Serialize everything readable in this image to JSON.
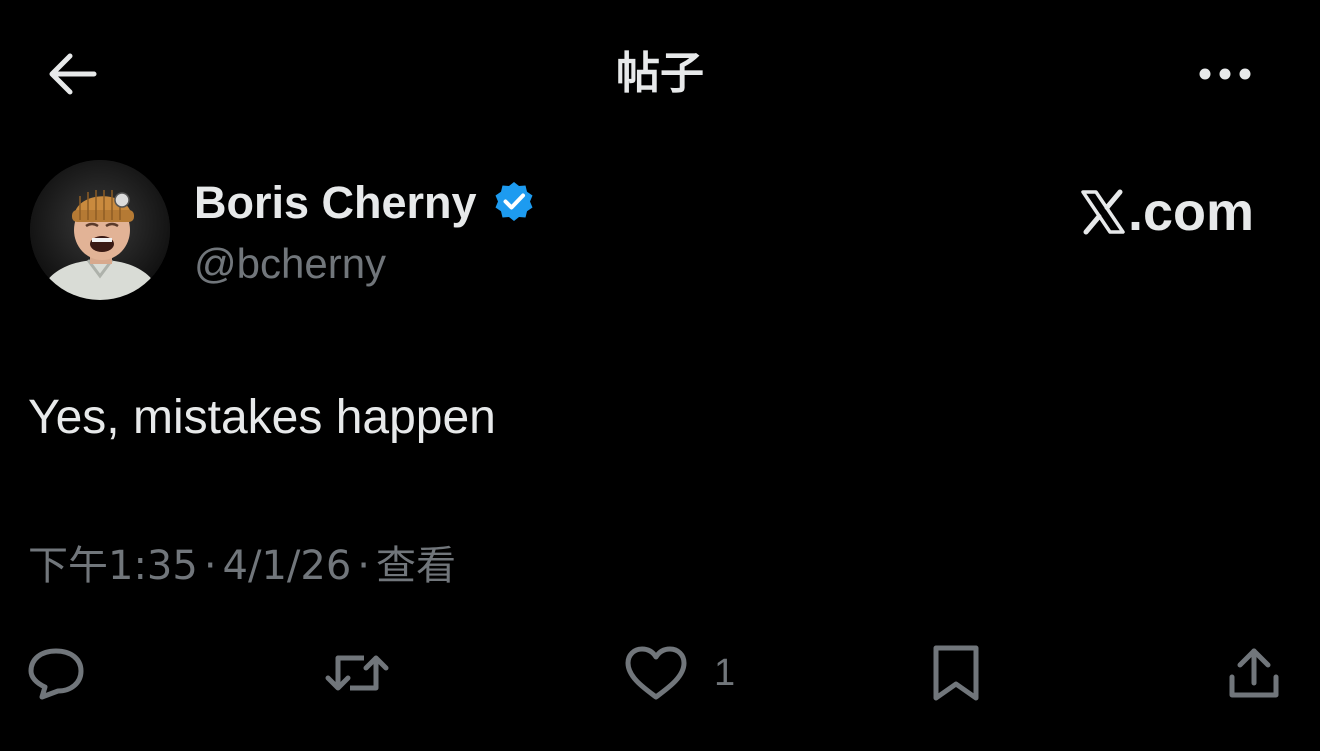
{
  "header": {
    "title": "帖子",
    "back_icon": "arrow-left-icon",
    "more_icon": "more-horizontal-icon"
  },
  "author": {
    "display_name": "Boris Cherny",
    "username": "@bcherny",
    "verified": true,
    "verified_color": "#1d9bf0"
  },
  "brand": {
    "text": ".com",
    "icon": "x-logo-icon"
  },
  "post": {
    "text": "Yes, mistakes happen"
  },
  "meta": {
    "time": "下午1:35",
    "separator": "·",
    "date": "4/1/26",
    "views_label": "查看"
  },
  "actions": {
    "reply_icon": "reply-icon",
    "repost_icon": "repost-icon",
    "like_icon": "heart-icon",
    "like_count": "1",
    "bookmark_icon": "bookmark-icon",
    "share_icon": "share-icon"
  },
  "colors": {
    "background": "#000000",
    "text": "#e7e9ea",
    "secondary": "#71767b",
    "accent": "#1d9bf0"
  }
}
